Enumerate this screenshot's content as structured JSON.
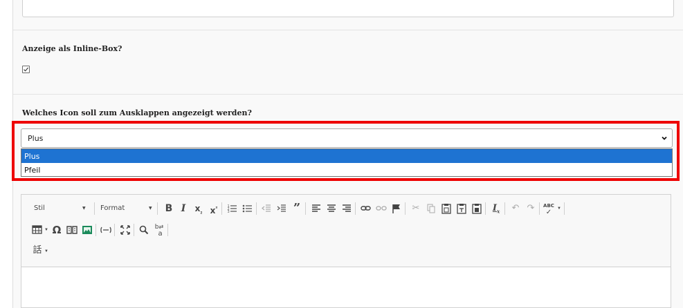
{
  "form": {
    "inline_box_label": "Anzeige als Inline-Box?",
    "inline_box_checked": true,
    "icon_label": "Welches Icon soll zum Ausklappen angezeigt werden?",
    "icon_select": {
      "value": "Plus",
      "options": [
        "Plus",
        "Pfeil"
      ]
    }
  },
  "editor": {
    "style_combo": "Stil",
    "format_combo": "Format",
    "toolbar_buttons": [
      "bold-icon",
      "italic-icon",
      "subscript-icon",
      "superscript-icon",
      "numbered-list-icon",
      "bulleted-list-icon",
      "outdent-icon",
      "indent-icon",
      "blockquote-icon",
      "align-left-icon",
      "align-center-icon",
      "align-right-icon",
      "link-icon",
      "unlink-icon",
      "anchor-icon",
      "cut-icon",
      "copy-icon",
      "paste-icon",
      "paste-text-icon",
      "paste-word-icon",
      "remove-format-icon",
      "undo-icon",
      "redo-icon",
      "spellcheck-icon",
      "table-icon",
      "special-char-icon",
      "templates-icon",
      "image-icon",
      "horizontal-line-icon",
      "maximize-icon",
      "find-icon",
      "replace-icon",
      "language-icon"
    ]
  }
}
